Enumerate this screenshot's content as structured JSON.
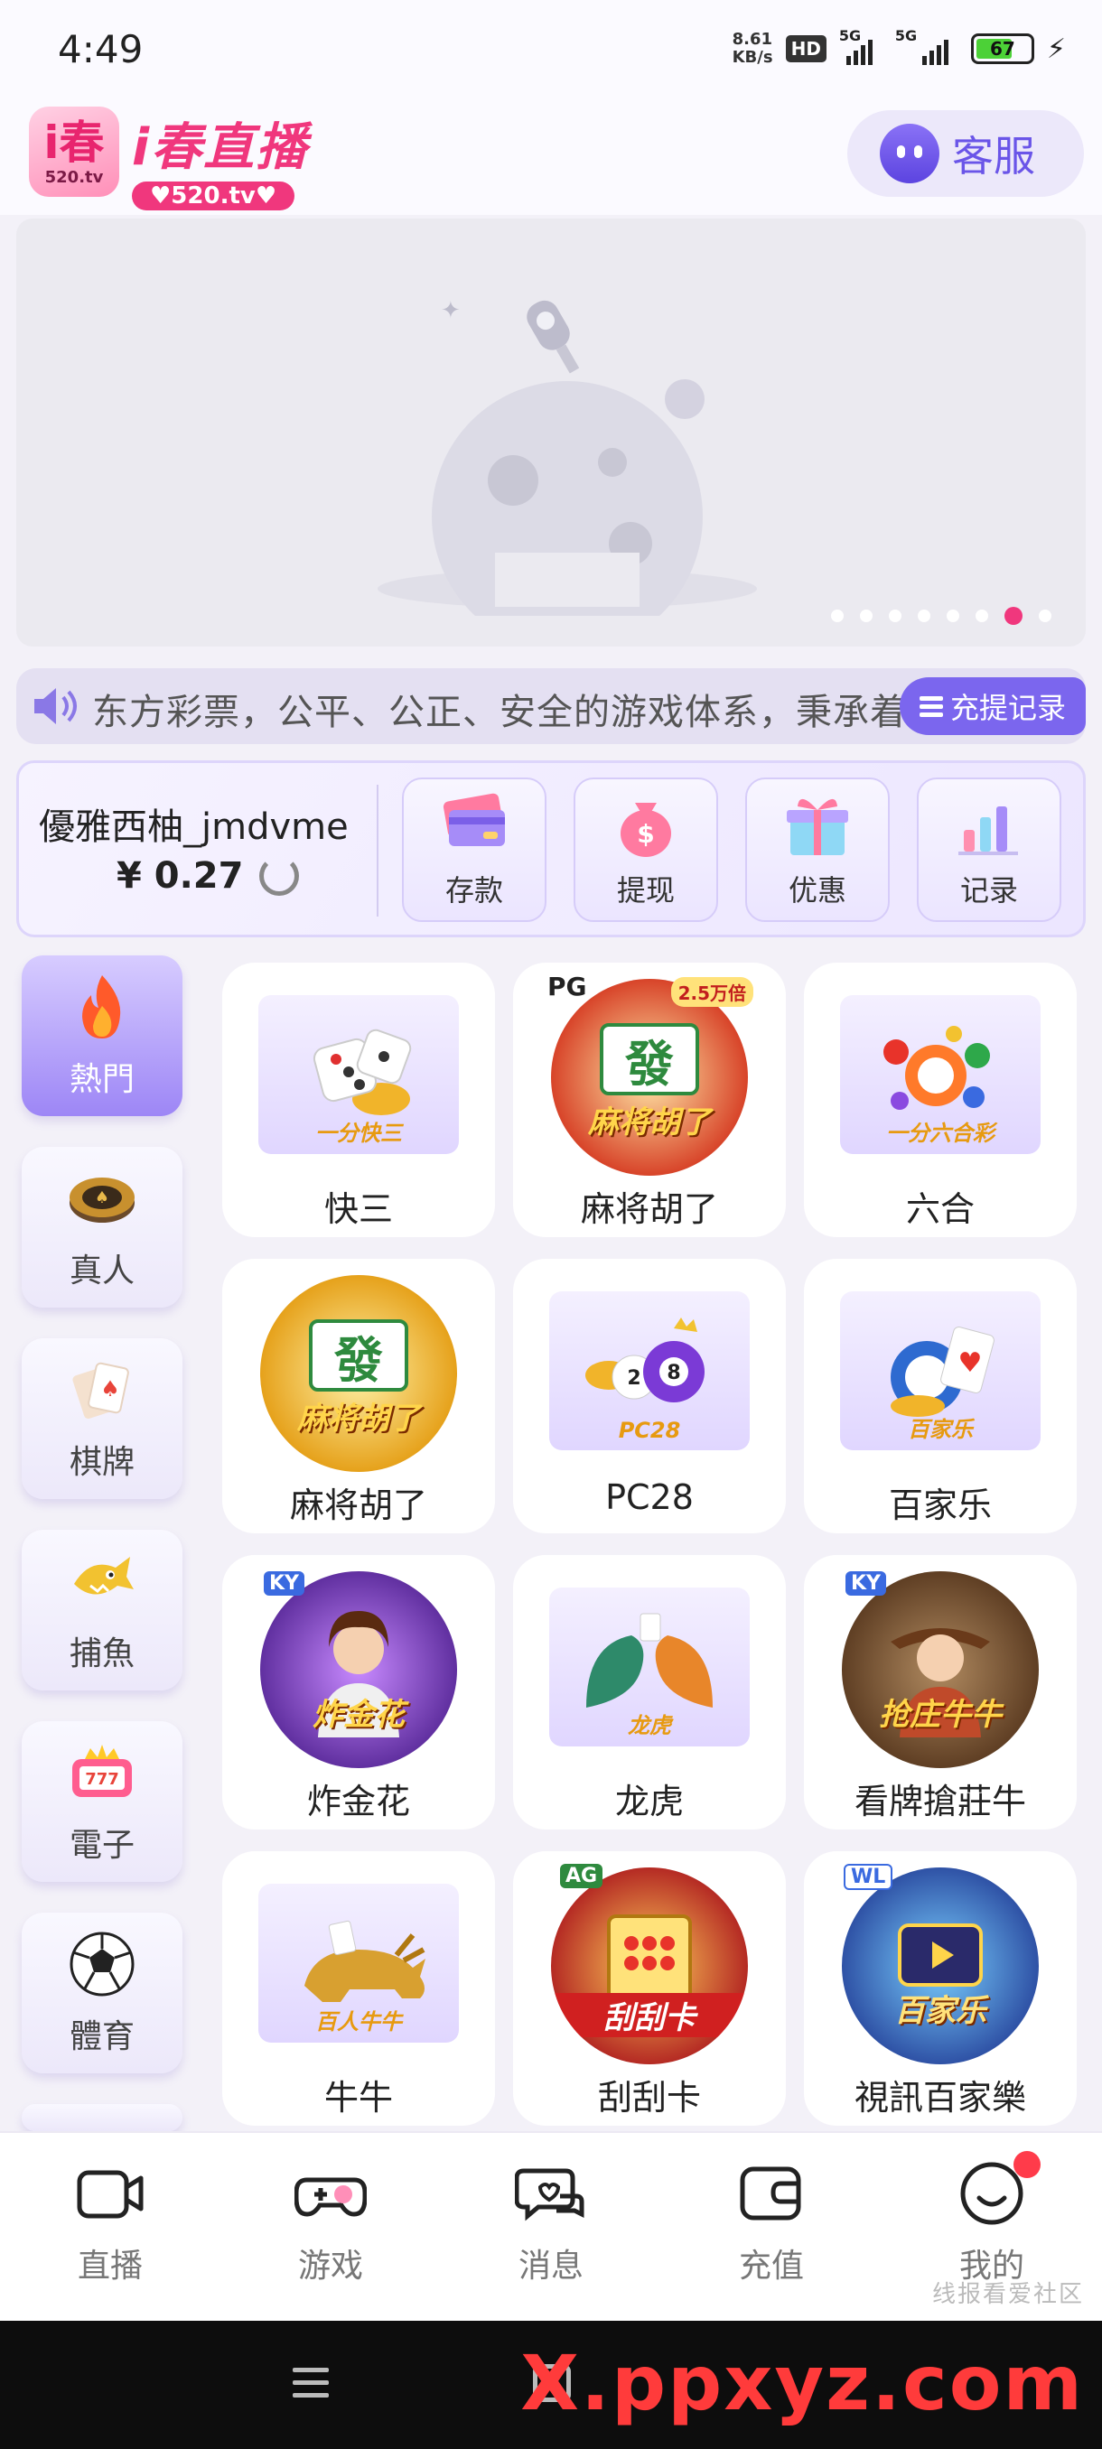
{
  "status_bar": {
    "time": "4:49",
    "net_speed": "8.61",
    "net_unit": "KB/s",
    "hd": "HD",
    "sig1": "5G",
    "sig2": "5G",
    "battery": "67"
  },
  "header": {
    "logo_char": "i春",
    "logo_domain": "520.tv",
    "app_name": "i春直播",
    "app_domain": "♥520.tv♥",
    "service_label": "客服"
  },
  "banner": {
    "slide_count": 8,
    "active_slide": 7
  },
  "marquee": {
    "text": "东方彩票，公平、公正、安全的游戏体系，秉承着",
    "record_button": "充提记录"
  },
  "user": {
    "name": "優雅西柚_jmdvme",
    "balance": "¥ 0.27"
  },
  "actions": [
    {
      "label": "存款",
      "icon": "card-icon"
    },
    {
      "label": "提现",
      "icon": "money-bag-icon"
    },
    {
      "label": "优惠",
      "icon": "gift-icon"
    },
    {
      "label": "记录",
      "icon": "bar-chart-icon"
    }
  ],
  "categories": [
    {
      "label": "熱門",
      "icon": "fire-icon",
      "active": true
    },
    {
      "label": "真人",
      "icon": "chip-icon"
    },
    {
      "label": "棋牌",
      "icon": "cards-icon"
    },
    {
      "label": "捕魚",
      "icon": "fish-icon"
    },
    {
      "label": "電子",
      "icon": "slot-icon"
    },
    {
      "label": "體育",
      "icon": "soccer-icon"
    }
  ],
  "games": [
    {
      "name": "快三",
      "caption": "一分快三"
    },
    {
      "name": "麻将胡了",
      "caption": "麻将胡了",
      "badge": "PG",
      "tag": "2.5万倍"
    },
    {
      "name": "六合",
      "caption": "一分六合彩"
    },
    {
      "name": "麻将胡了",
      "caption": "麻将胡了"
    },
    {
      "name": "PC28",
      "caption": "PC28"
    },
    {
      "name": "百家乐",
      "caption": "百家乐"
    },
    {
      "name": "炸金花",
      "caption": "炸金花",
      "badge": "KY"
    },
    {
      "name": "龙虎",
      "caption": "龙虎"
    },
    {
      "name": "看牌搶莊牛",
      "caption": "抢庄牛牛",
      "badge": "KY"
    },
    {
      "name": "牛牛",
      "caption": "百人牛牛"
    },
    {
      "name": "刮刮卡",
      "caption": "刮刮卡",
      "badge": "AG"
    },
    {
      "name": "視訊百家樂",
      "caption": "百家乐",
      "badge": "WL"
    }
  ],
  "bottom_nav": [
    {
      "label": "直播",
      "icon": "camera-icon"
    },
    {
      "label": "游戏",
      "icon": "gamepad-icon"
    },
    {
      "label": "消息",
      "icon": "chat-icon"
    },
    {
      "label": "充值",
      "icon": "wallet-icon"
    },
    {
      "label": "我的",
      "icon": "smile-icon"
    }
  ],
  "watermark": {
    "small": "线报看爱社区",
    "big": "X.ppxyz.com"
  },
  "colors": {
    "accent": "#7b66ee",
    "brand_pink": "#f0377d",
    "badge_red": "#ff3b4a"
  }
}
